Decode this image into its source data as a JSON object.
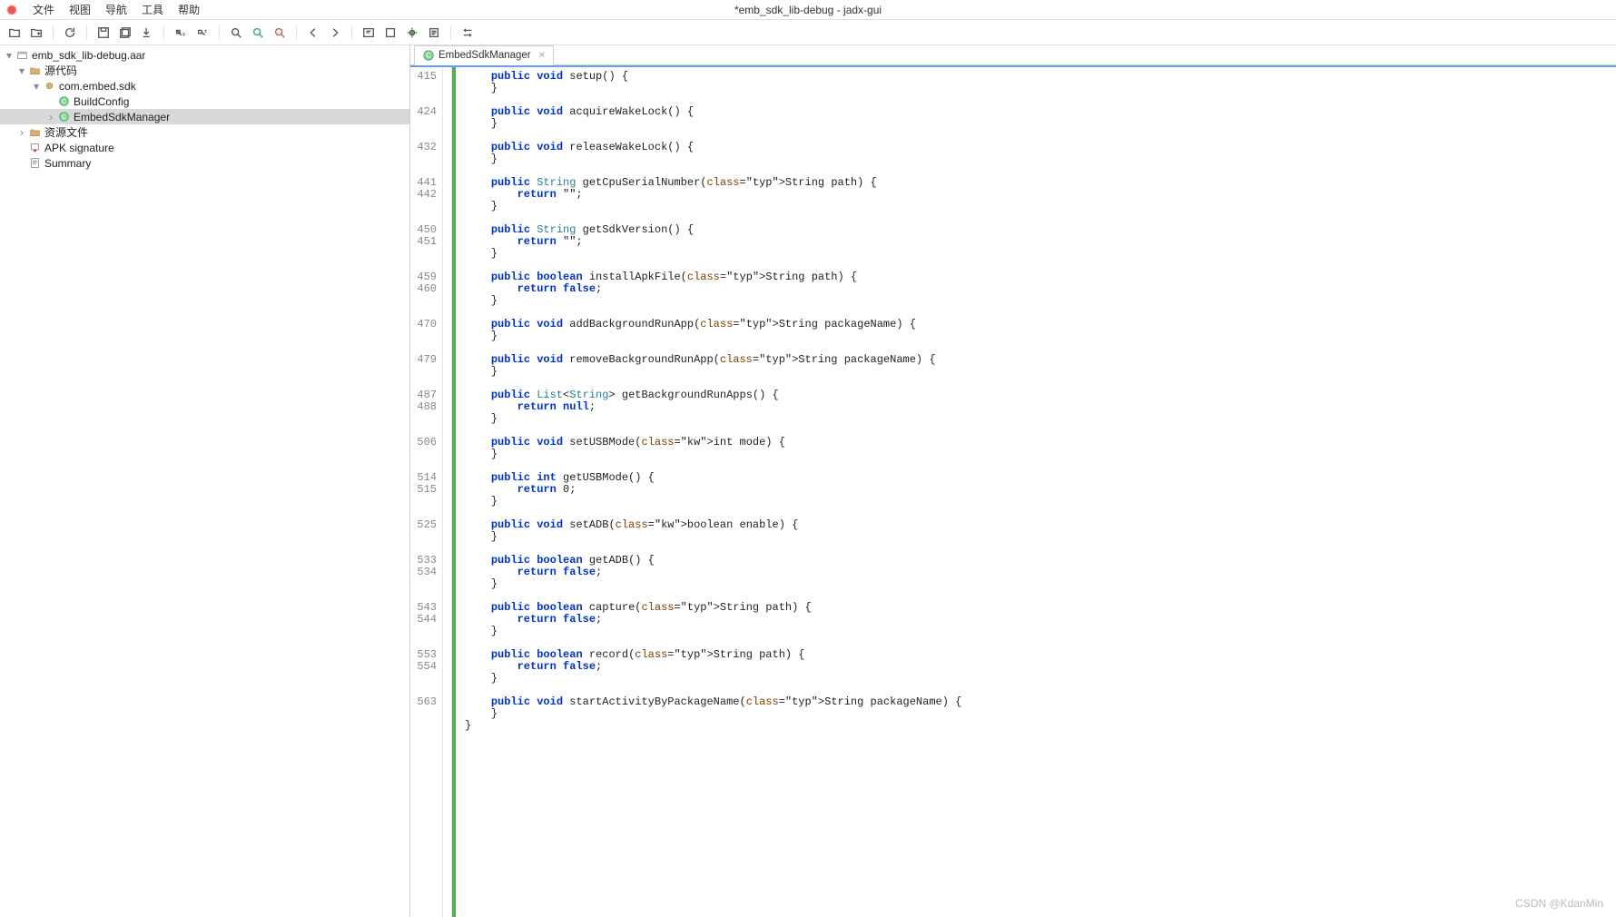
{
  "watermark": "CSDN @KdanMin",
  "title": "*emb_sdk_lib-debug - jadx-gui",
  "menu": {
    "file": "文件",
    "view": "视图",
    "nav": "导航",
    "tools": "工具",
    "help": "帮助"
  },
  "tree": {
    "root": "emb_sdk_lib-debug.aar",
    "src": "源代码",
    "pkg": "com.embed.sdk",
    "buildconfig": "BuildConfig",
    "mgr": "EmbedSdkManager",
    "res": "资源文件",
    "apk": "APK signature",
    "summary": "Summary"
  },
  "tab": {
    "label": "EmbedSdkManager"
  },
  "code": {
    "lines": [
      {
        "n": "415",
        "t": "    public void setup() {"
      },
      {
        "n": "",
        "t": "    }"
      },
      {
        "n": "",
        "t": ""
      },
      {
        "n": "424",
        "t": "    public void acquireWakeLock() {"
      },
      {
        "n": "",
        "t": "    }"
      },
      {
        "n": "",
        "t": ""
      },
      {
        "n": "432",
        "t": "    public void releaseWakeLock() {"
      },
      {
        "n": "",
        "t": "    }"
      },
      {
        "n": "",
        "t": ""
      },
      {
        "n": "441",
        "t": "    public String getCpuSerialNumber(String path) {"
      },
      {
        "n": "442",
        "t": "        return \"\";"
      },
      {
        "n": "",
        "t": "    }"
      },
      {
        "n": "",
        "t": ""
      },
      {
        "n": "450",
        "t": "    public String getSdkVersion() {"
      },
      {
        "n": "451",
        "t": "        return \"\";"
      },
      {
        "n": "",
        "t": "    }"
      },
      {
        "n": "",
        "t": ""
      },
      {
        "n": "459",
        "t": "    public boolean installApkFile(String path) {"
      },
      {
        "n": "460",
        "t": "        return false;"
      },
      {
        "n": "",
        "t": "    }"
      },
      {
        "n": "",
        "t": ""
      },
      {
        "n": "470",
        "t": "    public void addBackgroundRunApp(String packageName) {"
      },
      {
        "n": "",
        "t": "    }"
      },
      {
        "n": "",
        "t": ""
      },
      {
        "n": "479",
        "t": "    public void removeBackgroundRunApp(String packageName) {"
      },
      {
        "n": "",
        "t": "    }"
      },
      {
        "n": "",
        "t": ""
      },
      {
        "n": "487",
        "t": "    public List<String> getBackgroundRunApps() {"
      },
      {
        "n": "488",
        "t": "        return null;"
      },
      {
        "n": "",
        "t": "    }"
      },
      {
        "n": "",
        "t": ""
      },
      {
        "n": "506",
        "t": "    public void setUSBMode(int mode) {"
      },
      {
        "n": "",
        "t": "    }"
      },
      {
        "n": "",
        "t": ""
      },
      {
        "n": "514",
        "t": "    public int getUSBMode() {"
      },
      {
        "n": "515",
        "t": "        return 0;"
      },
      {
        "n": "",
        "t": "    }"
      },
      {
        "n": "",
        "t": ""
      },
      {
        "n": "525",
        "t": "    public void setADB(boolean enable) {"
      },
      {
        "n": "",
        "t": "    }"
      },
      {
        "n": "",
        "t": ""
      },
      {
        "n": "533",
        "t": "    public boolean getADB() {"
      },
      {
        "n": "534",
        "t": "        return false;"
      },
      {
        "n": "",
        "t": "    }"
      },
      {
        "n": "",
        "t": ""
      },
      {
        "n": "543",
        "t": "    public boolean capture(String path) {"
      },
      {
        "n": "544",
        "t": "        return false;"
      },
      {
        "n": "",
        "t": "    }"
      },
      {
        "n": "",
        "t": ""
      },
      {
        "n": "553",
        "t": "    public boolean record(String path) {"
      },
      {
        "n": "554",
        "t": "        return false;"
      },
      {
        "n": "",
        "t": "    }"
      },
      {
        "n": "",
        "t": ""
      },
      {
        "n": "563",
        "t": "    public void startActivityByPackageName(String packageName) {"
      },
      {
        "n": "",
        "t": "    }"
      },
      {
        "n": "",
        "t": "}"
      }
    ]
  }
}
